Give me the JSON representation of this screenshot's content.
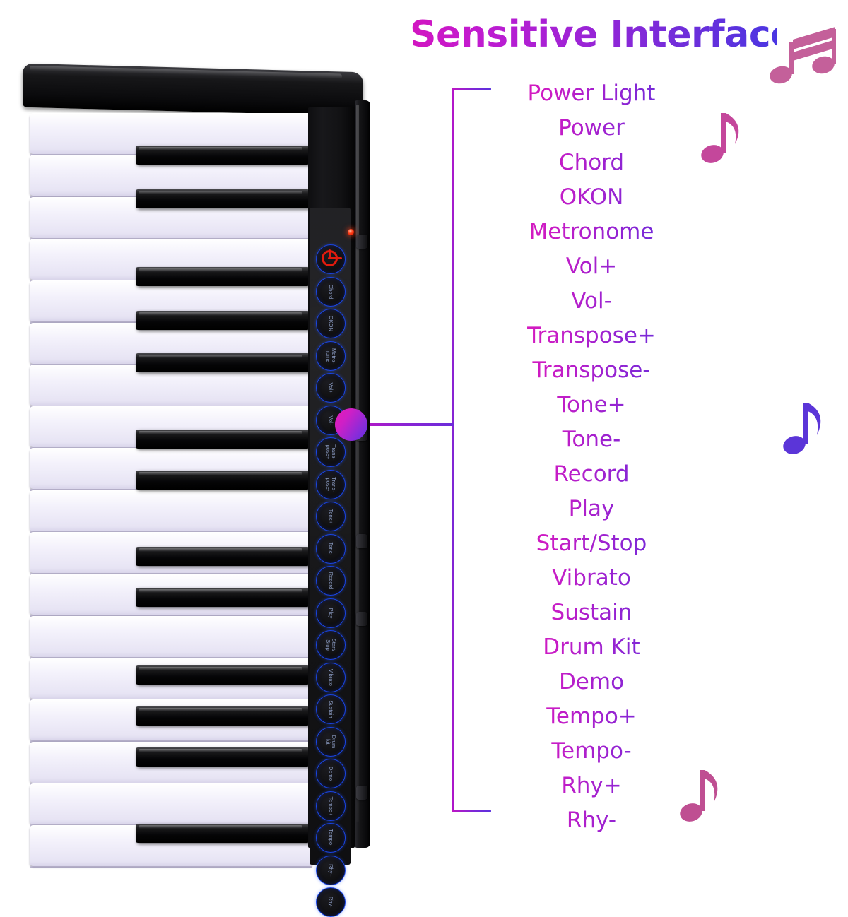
{
  "header": {
    "title": "Sensitive Interface",
    "title_gradient_start": "#d216c0",
    "title_gradient_end": "#4a36e2"
  },
  "callout": {
    "line_color_start": "#c015c4",
    "line_color_end": "#5a31dd",
    "dot_color_start": "#e61bb6",
    "dot_color_end": "#5a31e0"
  },
  "feature_labels": [
    {
      "text": "Power Light"
    },
    {
      "text": "Power"
    },
    {
      "text": "Chord"
    },
    {
      "text": "OKON"
    },
    {
      "text": "Metronome"
    },
    {
      "text": "Vol+"
    },
    {
      "text": "Vol-"
    },
    {
      "text": "Transpose+"
    },
    {
      "text": "Transpose-"
    },
    {
      "text": "Tone+"
    },
    {
      "text": "Tone-"
    },
    {
      "text": "Record"
    },
    {
      "text": "Play"
    },
    {
      "text": "Start/Stop"
    },
    {
      "text": "Vibrato"
    },
    {
      "text": "Sustain"
    },
    {
      "text": "Drum Kit"
    },
    {
      "text": "Demo"
    },
    {
      "text": "Tempo+"
    },
    {
      "text": "Tempo-"
    },
    {
      "text": "Rhy+"
    },
    {
      "text": "Rhy-"
    }
  ],
  "control_panel": {
    "led_color": "#ff3a12",
    "button_ring_color": "#1a46e8",
    "power_glyph_color": "#e11b0e",
    "buttons": [
      {
        "caption": "",
        "icon": "power-icon",
        "is_power": true
      },
      {
        "caption": "Chord"
      },
      {
        "caption": "OKON"
      },
      {
        "caption": "Metro-\nnome"
      },
      {
        "caption": "Vol+"
      },
      {
        "caption": "Vol-"
      },
      {
        "caption": "Trans-\npose+"
      },
      {
        "caption": "Trans-\npose-"
      },
      {
        "caption": "Tone+"
      },
      {
        "caption": "Tone-"
      },
      {
        "caption": "Record"
      },
      {
        "caption": "Play"
      },
      {
        "caption": "Start/\nStop"
      },
      {
        "caption": "Vibrato"
      },
      {
        "caption": "Sustain"
      },
      {
        "caption": "Drum\nkit"
      },
      {
        "caption": "Demo"
      },
      {
        "caption": "Tempo+"
      },
      {
        "caption": "Tempo-"
      },
      {
        "caption": "Rhy+"
      },
      {
        "caption": "Rhy-"
      }
    ]
  },
  "keyboard": {
    "white_key_count": 18,
    "black_key_count": 13,
    "white_key_color": "#f3f1fb",
    "black_key_color": "#050506",
    "body_color": "#121214"
  },
  "decorations": {
    "notes": [
      {
        "name": "beamed-eighth-notes-icon",
        "color": "#c4609a"
      },
      {
        "name": "eighth-note-icon",
        "color": "#c4479b"
      },
      {
        "name": "eighth-note-icon",
        "color": "#5b35d8"
      },
      {
        "name": "eighth-note-icon",
        "color": "#bf4f92"
      }
    ]
  }
}
